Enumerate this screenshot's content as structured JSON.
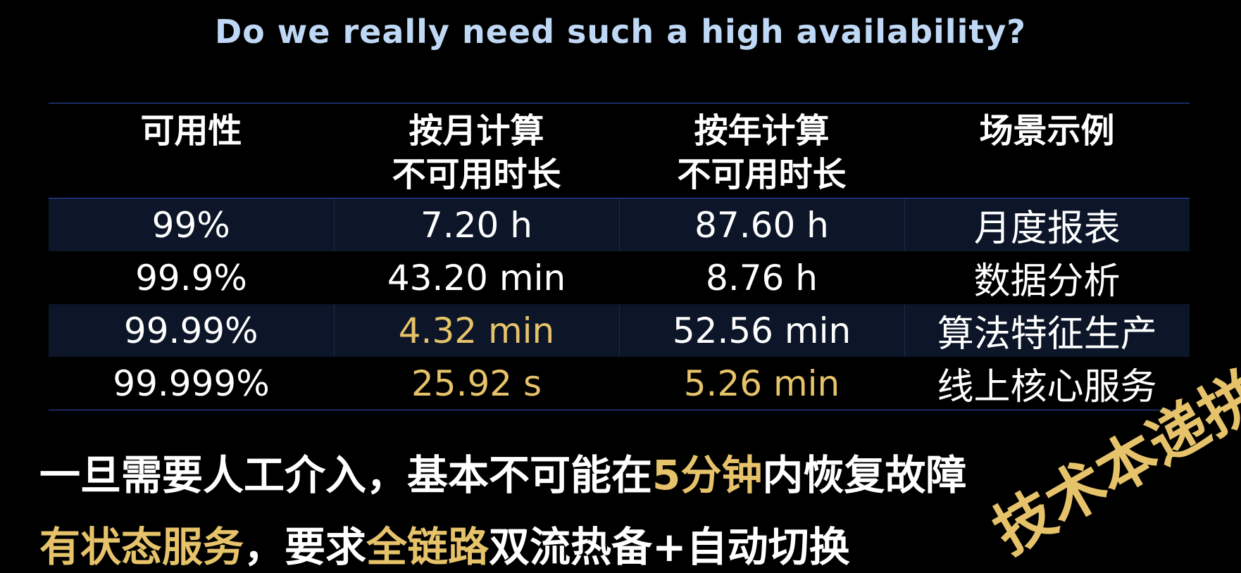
{
  "slide": {
    "title": "Do we really need such a high availability?"
  },
  "table": {
    "headers": [
      {
        "line1": "可用性",
        "line2": ""
      },
      {
        "line1": "按月计算",
        "line2": "不可用时长"
      },
      {
        "line1": "按年计算",
        "line2": "不可用时长"
      },
      {
        "line1": "场景示例",
        "line2": ""
      }
    ],
    "rows": [
      {
        "availability": "99%",
        "monthly": "7.20 h",
        "yearly": "87.60 h",
        "scene": "月度报表"
      },
      {
        "availability": "99.9%",
        "monthly": "43.20 min",
        "yearly": "8.76 h",
        "scene": "数据分析"
      },
      {
        "availability": "99.99%",
        "monthly": "4.32 min",
        "yearly": "52.56 min",
        "scene": "算法特征生产"
      },
      {
        "availability": "99.999%",
        "monthly": "25.92 s",
        "yearly": "5.26 min",
        "scene": "线上核心服务"
      }
    ]
  },
  "statements": {
    "line1": {
      "part1": "一旦需要人工介入，基本不可能在",
      "highlight": "5分钟",
      "part2": "内恢复故障"
    },
    "line2": {
      "highlight1": "有状态服务",
      "part1": "，要求",
      "highlight2": "全链路",
      "part2": "双流热备+自动切换"
    }
  },
  "watermark": "技术本递拼",
  "colors": {
    "background": "#000000",
    "title": "#bfd8f5",
    "highlight": "#e6c36a",
    "row_shade": "#0c1628",
    "rule": "#2e4fb8"
  }
}
